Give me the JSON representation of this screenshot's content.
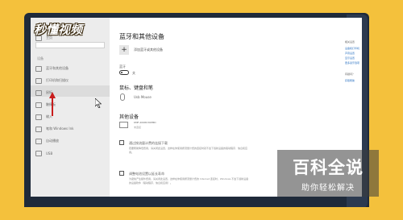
{
  "brand": {
    "logo_text": "秒懂视频"
  },
  "sidebar": {
    "home": "主页",
    "section": "设备",
    "items": [
      {
        "label": "蓝牙和其他设备",
        "icon": "bluetooth-icon"
      },
      {
        "label": "打印机和扫描仪",
        "icon": "printer-icon"
      },
      {
        "label": "鼠标",
        "icon": "mouse-icon"
      },
      {
        "label": "触摸板",
        "icon": "touchpad-icon"
      },
      {
        "label": "输入",
        "icon": "keyboard-icon"
      },
      {
        "label": "笔和 Windows Ink",
        "icon": "pen-icon"
      },
      {
        "label": "自动播放",
        "icon": "autoplay-icon"
      },
      {
        "label": "USB",
        "icon": "usb-icon"
      }
    ]
  },
  "main": {
    "title": "蓝牙和其他设备",
    "add_label": "添加蓝牙或其他设备",
    "bluetooth_label": "蓝牙",
    "bluetooth_state": "关",
    "mouse_section": "鼠标、键盘和笔",
    "mouse_device": "Usb Mouse",
    "other_section": "其他设备",
    "other_device_name": "KMF-2098C30PMD",
    "other_device_status": "未连接",
    "metered_label": "通过按流量计费的连接下载",
    "metered_desc": "若要帮助降低费用，请关闭此设置，这样在你使用按流量计费的连接时就不会下载新设备的驱动程序、信息和应用。",
    "battery_label": "调整电池设置以延长寿命",
    "battery_desc": "为避免产生额外费用，请关闭此设置，这样在你使用按流量计费的 Internet 连接时，Windows 不会下载新设备的设备软件（驱动程序、信息和应用）。"
  },
  "right_panel": {
    "related_title": "相关设置",
    "related_links": [
      "设备和打印机",
      "声音设置",
      "显示设置",
      "更多蓝牙选项"
    ],
    "help_title": "有疑问？",
    "help_links": [
      "获取帮助"
    ]
  },
  "watermark": {
    "title": "百科全说",
    "subtitle": "助你轻松解决"
  },
  "colors": {
    "background": "#f4c13c",
    "accent": "#2b72c2",
    "monitor": "#1f2a3a"
  }
}
